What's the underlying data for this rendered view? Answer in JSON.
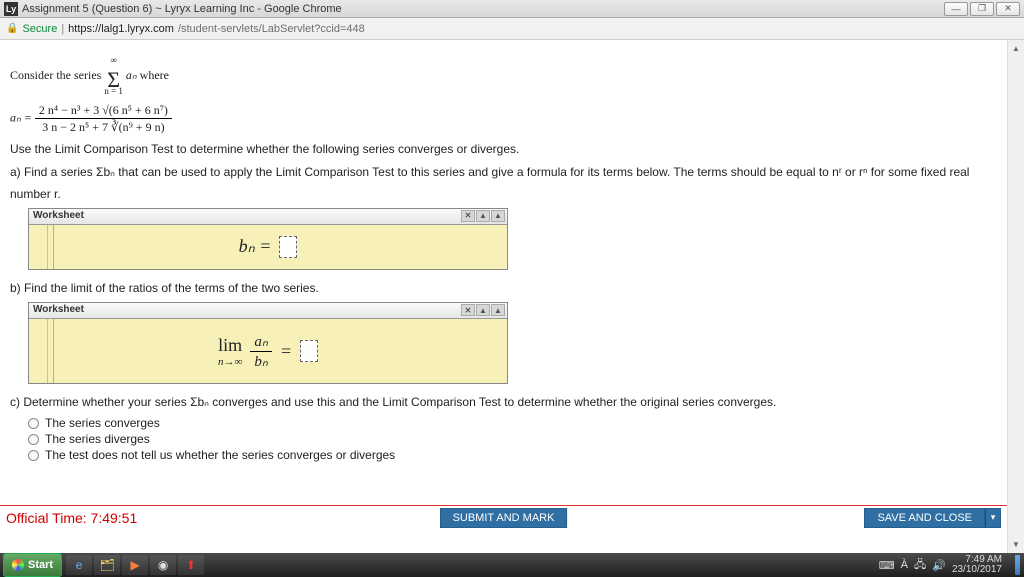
{
  "window": {
    "tab_title": "Assignment 5 (Question 6) ~ Lyryx Learning Inc - Google Chrome",
    "favicon_text": "Ly"
  },
  "url": {
    "secure_label": "Secure",
    "host": "https://lalg1.lyryx.com",
    "path": "/student-servlets/LabServlet?ccid=448"
  },
  "problem": {
    "intro_prefix": "Consider the series ",
    "intro_suffix": " where",
    "sigma_top": "∞",
    "sigma_bottom": "n = 1",
    "sigma_term": "aₙ",
    "an_lhs": "aₙ =",
    "an_num": "2 n⁴ − n³ + 3 √(6 n⁵ + 6 n⁷)",
    "an_den": "3 n − 2 n⁵ + 7 ∛(n⁹ + 9 n)",
    "instruction": "Use the Limit Comparison Test to determine whether the following series converges or diverges.",
    "part_a": "a) Find a series Σbₙ that can be used to apply the Limit Comparison Test to this series and give a formula for its terms below. The terms should be equal to nʳ or rⁿ for some fixed real",
    "part_a_line2": "number r.",
    "worksheet_label": "Worksheet",
    "ws_a_expr": "bₙ  =",
    "part_b": "b) Find the limit of the ratios of the terms of the two series.",
    "ws_b_lim": "lim",
    "ws_b_sub": "n→∞",
    "ws_b_frac_num": "aₙ",
    "ws_b_frac_den": "bₙ",
    "ws_b_eq": "=",
    "part_c": "c) Determine whether your series Σbₙ converges and use this and the Limit Comparison Test to determine whether the original series converges.",
    "options": [
      "The series converges",
      "The series diverges",
      "The test does not tell us whether the series converges or diverges"
    ]
  },
  "footer": {
    "official_time_label": "Official Time: ",
    "official_time_value": "7:49:51",
    "submit": "SUBMIT AND MARK",
    "save": "SAVE AND CLOSE"
  },
  "taskbar": {
    "start": "Start",
    "clock_time": "7:49 AM",
    "clock_date": "23/10/2017"
  }
}
